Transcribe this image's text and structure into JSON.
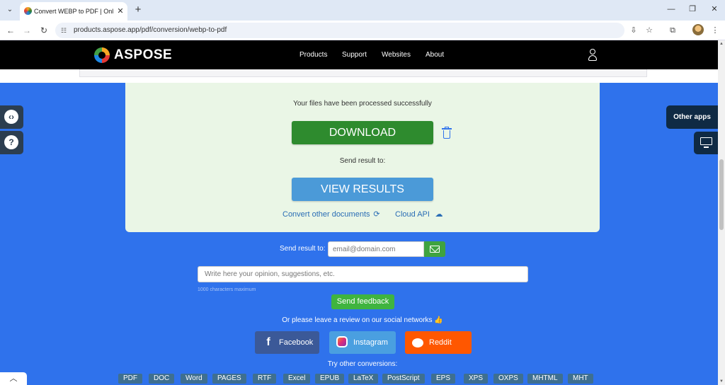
{
  "browser": {
    "tab_title": "Convert WEBP to PDF | Online",
    "tab_close": "✕",
    "new_tab": "+",
    "url": "products.aspose.app/pdf/conversion/webp-to-pdf",
    "controls": {
      "minimize": "—",
      "restore": "❐",
      "close": "✕"
    }
  },
  "header": {
    "logo": "ASPOSE",
    "nav": [
      "Products",
      "Support",
      "Websites",
      "About"
    ]
  },
  "result": {
    "success_message": "Your files have been processed successfully",
    "download_label": "DOWNLOAD",
    "send_result_label": "Send result to:",
    "view_results_label": "VIEW RESULTS",
    "convert_other_label": "Convert other documents",
    "cloud_api_label": "Cloud API"
  },
  "email": {
    "label": "Send result to:",
    "placeholder": "email@domain.com"
  },
  "feedback": {
    "placeholder": "Write here your opinion, suggestions, etc.",
    "hint": "1000 characters maximum",
    "button_label": "Send feedback"
  },
  "social": {
    "prompt": "Or please leave a review on our social networks 👍",
    "facebook": "Facebook",
    "instagram": "Instagram",
    "reddit": "Reddit"
  },
  "conversions": {
    "title": "Try other conversions:",
    "items": [
      "PDF",
      "DOC",
      "Word",
      "PAGES",
      "RTF",
      "Excel",
      "EPUB",
      "LaTeX",
      "PostScript",
      "EPS",
      "XPS",
      "OXPS",
      "MHTML",
      "MHT"
    ]
  },
  "side": {
    "other_apps": "Other apps"
  },
  "colors": {
    "page_blue": "#2f72ec",
    "download_green": "#2e8b2e",
    "view_blue": "#4b9ad8",
    "card_bg": "#eaf6e6"
  }
}
